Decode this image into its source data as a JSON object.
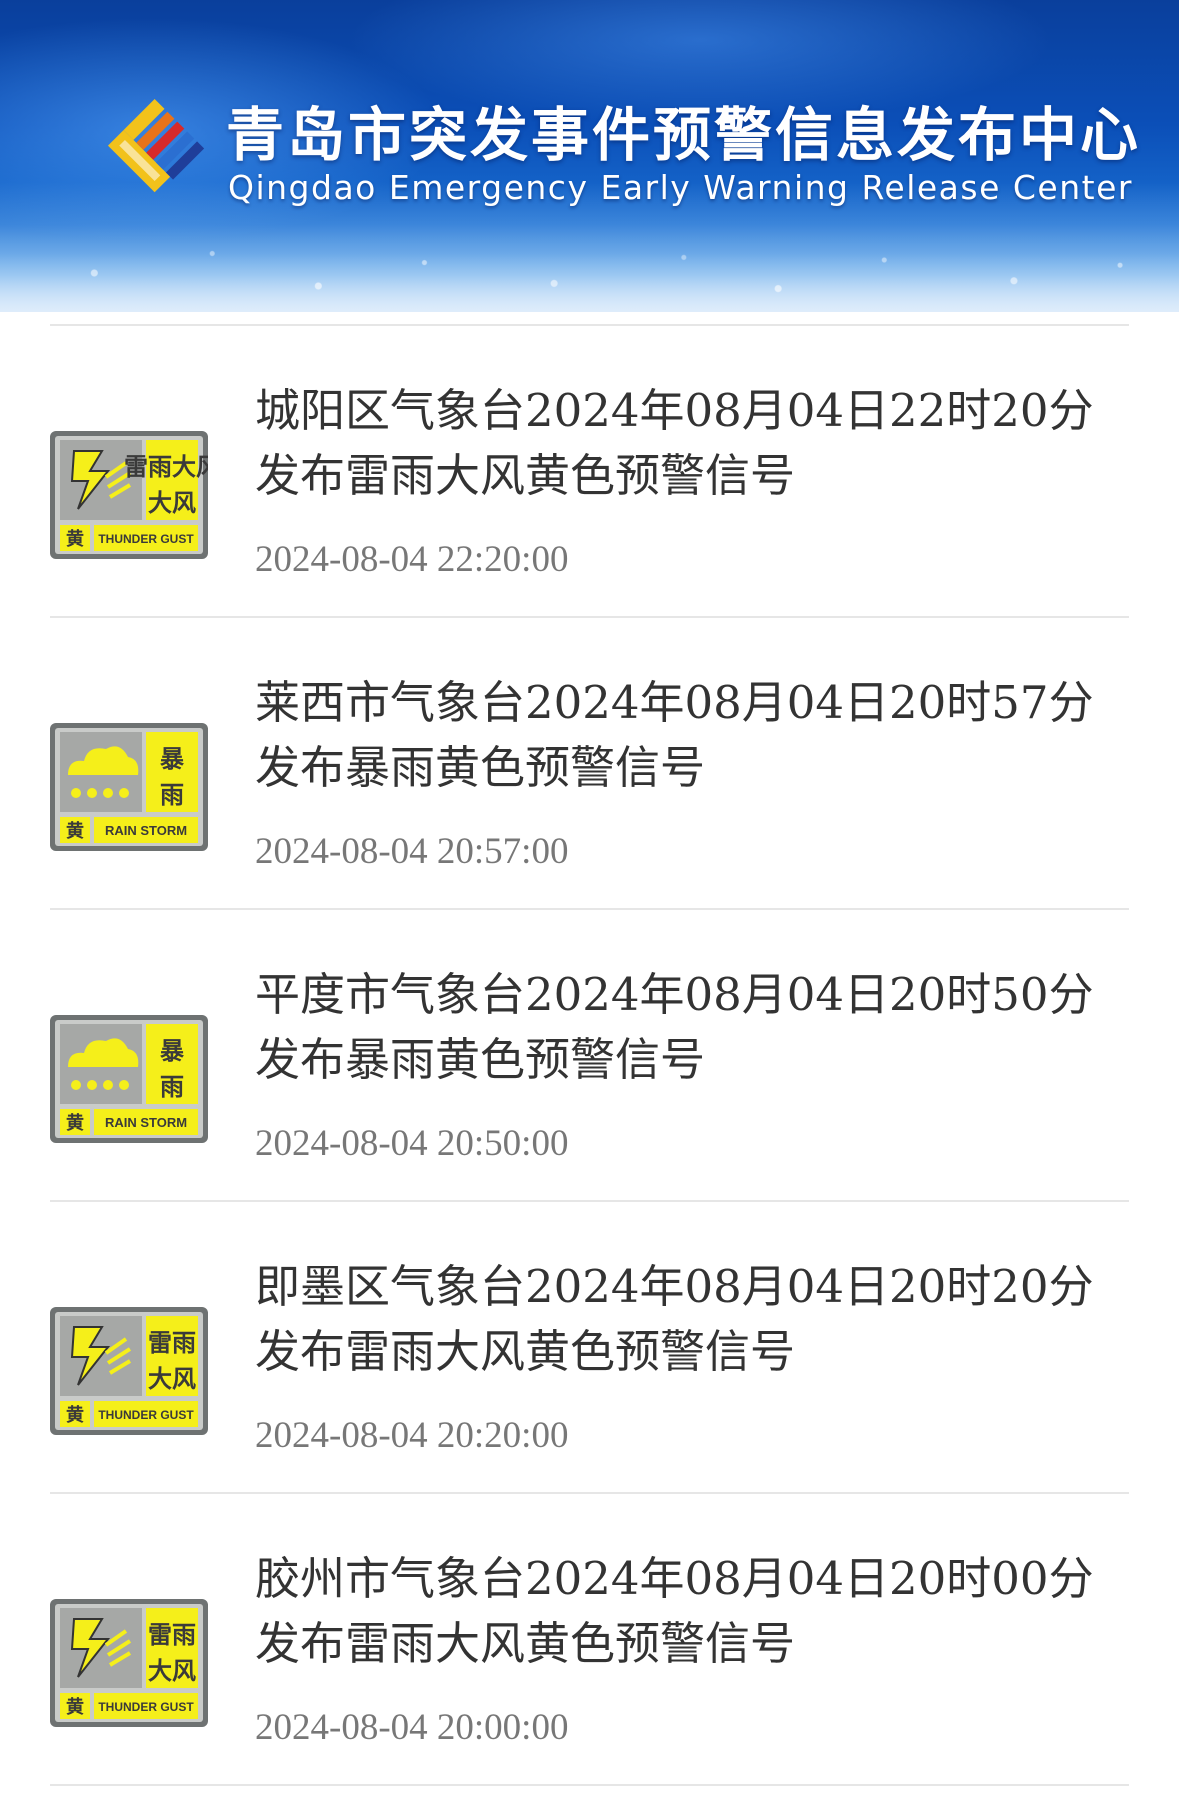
{
  "header": {
    "title_cn": "青岛市突发事件预警信息发布中心",
    "title_en": "Qingdao Emergency Early Warning Release Center",
    "logo_icon": "qingdao-warning-center-logo"
  },
  "colors": {
    "banner_blue": "#0b4fb8",
    "warning_yellow": "#f5ef1a",
    "icon_gray": "#a6a8a6",
    "title_text": "#333333",
    "time_text": "#777777"
  },
  "warnings": [
    {
      "title": "城阳区气象台2024年08月04日22时20分发布雷雨大风黄色预警信号",
      "time": "2024-08-04 22:20:00",
      "icon": "thunder-gust-yellow-icon",
      "icon_label_cn": "雷雨大风",
      "icon_level": "黄",
      "icon_label_en": "THUNDER GUST"
    },
    {
      "title": "莱西市气象台2024年08月04日20时57分发布暴雨黄色预警信号",
      "time": "2024-08-04 20:57:00",
      "icon": "rainstorm-yellow-icon",
      "icon_label_cn": "暴雨",
      "icon_level": "黄",
      "icon_label_en": "RAIN STORM"
    },
    {
      "title": "平度市气象台2024年08月04日20时50分发布暴雨黄色预警信号",
      "time": "2024-08-04 20:50:00",
      "icon": "rainstorm-yellow-icon",
      "icon_label_cn": "暴雨",
      "icon_level": "黄",
      "icon_label_en": "RAIN STORM"
    },
    {
      "title": "即墨区气象台2024年08月04日20时20分发布雷雨大风黄色预警信号",
      "time": "2024-08-04 20:20:00",
      "icon": "thunder-gust-yellow-icon",
      "icon_label_cn": "雷雨大风",
      "icon_level": "黄",
      "icon_label_en": "THUNDER GUST"
    },
    {
      "title": "胶州市气象台2024年08月04日20时00分发布雷雨大风黄色预警信号",
      "time": "2024-08-04 20:00:00",
      "icon": "thunder-gust-yellow-icon",
      "icon_label_cn": "雷雨大风",
      "icon_level": "黄",
      "icon_label_en": "THUNDER GUST"
    }
  ]
}
